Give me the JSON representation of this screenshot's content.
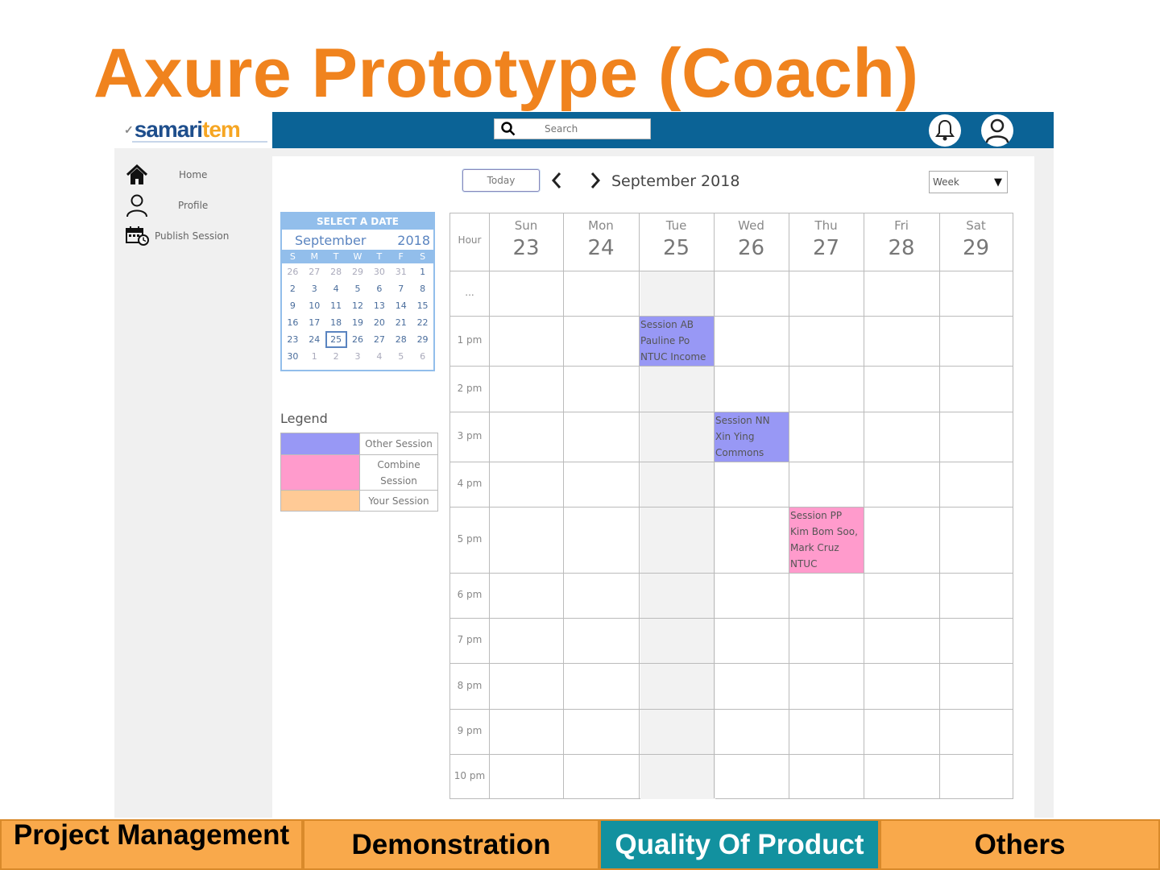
{
  "slide": {
    "title": "Axure Prototype (Coach)"
  },
  "brand": {
    "logo_main": "samari",
    "logo_accent": "tem"
  },
  "search": {
    "placeholder": "Search"
  },
  "sidebar": {
    "items": [
      {
        "label": "Home",
        "icon": "home-icon"
      },
      {
        "label": "Profile",
        "icon": "user-icon"
      },
      {
        "label": "Publish Session",
        "icon": "calendar-clock-icon"
      }
    ]
  },
  "toolbar": {
    "today_label": "Today",
    "month_label": "September 2018",
    "view_selected": "Week",
    "dropdown_arrow": "▼"
  },
  "date_picker": {
    "header": "SELECT A DATE",
    "month": "September",
    "year": "2018",
    "weekdays": [
      "S",
      "M",
      "T",
      "W",
      "T",
      "F",
      "S"
    ],
    "weeks": [
      [
        "26",
        "27",
        "28",
        "29",
        "30",
        "31",
        "1"
      ],
      [
        "2",
        "3",
        "4",
        "5",
        "6",
        "7",
        "8"
      ],
      [
        "9",
        "10",
        "11",
        "12",
        "13",
        "14",
        "15"
      ],
      [
        "16",
        "17",
        "18",
        "19",
        "20",
        "21",
        "22"
      ],
      [
        "23",
        "24",
        "25",
        "26",
        "27",
        "28",
        "29"
      ],
      [
        "30",
        "1",
        "2",
        "3",
        "4",
        "5",
        "6"
      ]
    ],
    "selected": "25"
  },
  "legend": {
    "title": "Legend",
    "items": [
      {
        "label": "Other Session",
        "color": "#9898F5"
      },
      {
        "label": "Combine Session",
        "color": "#FF9BCC"
      },
      {
        "label": "Your Session",
        "color": "#FFCA96"
      }
    ]
  },
  "week": {
    "hour_header": "Hour",
    "days": [
      {
        "name": "Sun",
        "num": "23"
      },
      {
        "name": "Mon",
        "num": "24"
      },
      {
        "name": "Tue",
        "num": "25"
      },
      {
        "name": "Wed",
        "num": "26"
      },
      {
        "name": "Thu",
        "num": "27"
      },
      {
        "name": "Fri",
        "num": "28"
      },
      {
        "name": "Sat",
        "num": "29"
      }
    ],
    "hours": [
      "...",
      "1 pm",
      "2 pm",
      "3 pm",
      "4 pm",
      "5 pm",
      "6 pm",
      "7 pm",
      "8 pm",
      "9 pm",
      "10 pm"
    ],
    "events": [
      {
        "lines": [
          "Session AB",
          "Pauline Po",
          "NTUC Income"
        ],
        "type": "other"
      },
      {
        "lines": [
          "Session NN",
          "Xin Ying",
          "Commons"
        ],
        "type": "other"
      },
      {
        "lines": [
          "Session PP",
          "Kim Bom Soo,",
          "Mark Cruz",
          "NTUC"
        ],
        "type": "combine"
      }
    ]
  },
  "fab": {
    "icon": "plus-icon"
  },
  "nav_tabs": [
    {
      "label": "Project Management",
      "active": false
    },
    {
      "label": "Demonstration",
      "active": false
    },
    {
      "label": "Quality Of Product",
      "active": true
    },
    {
      "label": "Others",
      "active": false
    }
  ]
}
